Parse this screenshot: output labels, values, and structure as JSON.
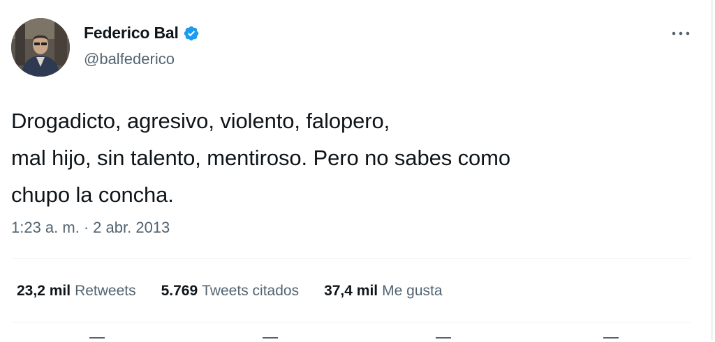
{
  "author": {
    "display_name": "Federico Bal",
    "handle": "@balfederico",
    "verified_icon": "verified-badge-icon",
    "avatar_icon": "profile-photo"
  },
  "tweet": {
    "text": "Drogadicto, agresivo, violento, falopero,\nmal hijo, sin talento, mentiroso. Pero no sabes como\nchupo la concha.",
    "time": "1:23 a. m.",
    "separator": "·",
    "date": "2 abr. 2013"
  },
  "stats": [
    {
      "value": "23,2 mil",
      "label": "Retweets"
    },
    {
      "value": "5.769",
      "label": "Tweets citados"
    },
    {
      "value": "37,4 mil",
      "label": "Me gusta"
    }
  ],
  "colors": {
    "primary_text": "#0f1419",
    "secondary_text": "#536471",
    "verified_blue": "#1d9bf0",
    "divider": "#eff3f4"
  },
  "icons": {
    "more": "more-options-icon",
    "reply": "reply-icon",
    "retweet": "retweet-icon",
    "like": "like-icon",
    "share": "share-icon"
  }
}
